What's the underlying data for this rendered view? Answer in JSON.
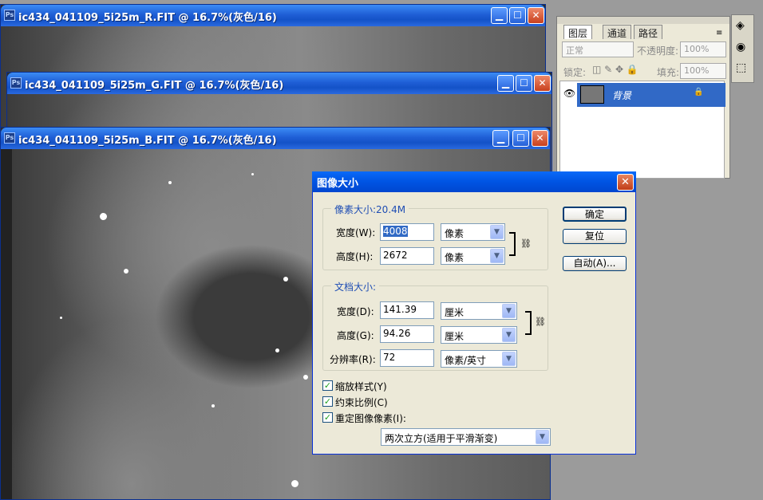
{
  "documents": [
    {
      "title": "ic434_041109_5i25m_R.FIT @ 16.7%(灰色/16)"
    },
    {
      "title": "ic434_041109_5i25m_G.FIT @ 16.7%(灰色/16)"
    },
    {
      "title": "ic434_041109_5i25m_B.FIT @ 16.7%(灰色/16)"
    }
  ],
  "layers_panel": {
    "tabs": [
      "图层",
      "通道",
      "路径"
    ],
    "blend_mode": "正常",
    "opacity_label": "不透明度:",
    "opacity_value": "100%",
    "lock_label": "锁定:",
    "fill_label": "填充:",
    "fill_value": "100%",
    "layer_name": "背景"
  },
  "dialog": {
    "title": "图像大小",
    "pixel_dims_legend": "像素大小:20.4M",
    "width_label": "宽度(W):",
    "width_value": "4008",
    "width_unit": "像素",
    "height_label": "高度(H):",
    "height_value": "2672",
    "height_unit": "像素",
    "doc_size_legend": "文档大小:",
    "doc_width_label": "宽度(D):",
    "doc_width_value": "141.39",
    "doc_width_unit": "厘米",
    "doc_height_label": "高度(G):",
    "doc_height_value": "94.26",
    "doc_height_unit": "厘米",
    "resolution_label": "分辨率(R):",
    "resolution_value": "72",
    "resolution_unit": "像素/英寸",
    "scale_styles": "缩放样式(Y)",
    "constrain": "约束比例(C)",
    "resample": "重定图像像素(I):",
    "resample_method": "两次立方(适用于平滑渐变)",
    "ok": "确定",
    "reset": "复位",
    "auto": "自动(A)..."
  }
}
